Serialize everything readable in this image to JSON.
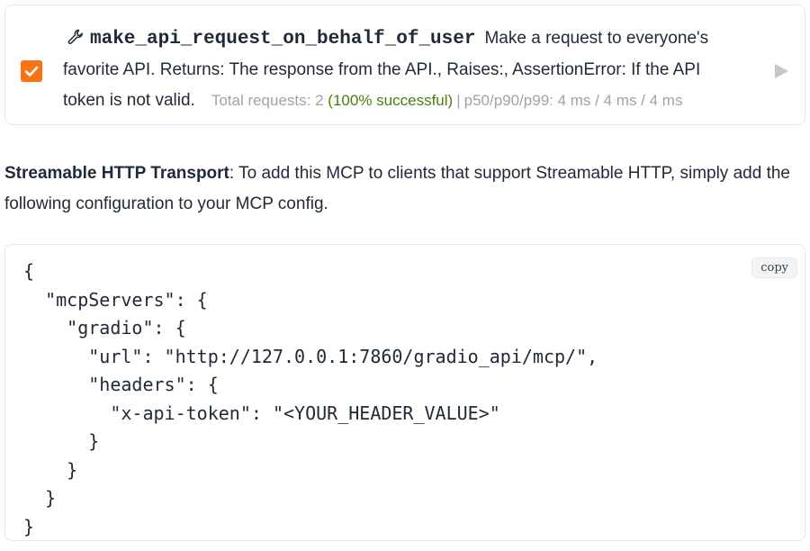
{
  "tool": {
    "checked": true,
    "icon": "wrench-icon",
    "name": "make_api_request_on_behalf_of_user",
    "description_line1": "Make a request to everyone's",
    "description_line2": "favorite API. Returns: The response from the API., Raises:, AssertionError: If the API",
    "description_line3": "token is not valid.",
    "stats_requests": "Total requests: 2",
    "stats_success": "(100% successful)",
    "stats_separator": "|",
    "stats_latency": "p50/p90/p99: 4 ms / 4 ms / 4 ms",
    "expand_icon": "play-triangle-icon"
  },
  "transport": {
    "label": "Streamable HTTP Transport",
    "text": ": To add this MCP to clients that support Streamable HTTP, simply add the following configuration to your MCP config."
  },
  "code": {
    "copy_label": "copy",
    "content": "{\n  \"mcpServers\": {\n    \"gradio\": {\n      \"url\": \"http://127.0.0.1:7860/gradio_api/mcp/\",\n      \"headers\": {\n        \"x-api-token\": \"<YOUR_HEADER_VALUE>\"\n      }\n    }\n  }\n}"
  },
  "colors": {
    "checkbox": "#f97316",
    "success": "#4d7c0f",
    "muted": "#9ca3af"
  }
}
